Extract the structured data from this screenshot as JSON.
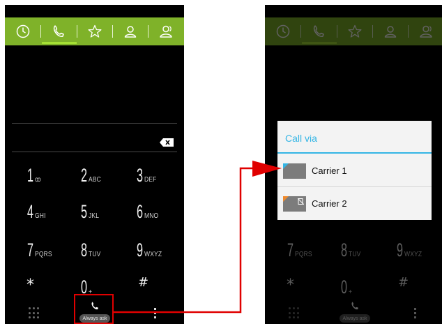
{
  "dialer": {
    "keys": [
      {
        "digit": "1",
        "letters": "ꝏ"
      },
      {
        "digit": "2",
        "letters": "ABC"
      },
      {
        "digit": "3",
        "letters": "DEF"
      },
      {
        "digit": "4",
        "letters": "GHI"
      },
      {
        "digit": "5",
        "letters": "JKL"
      },
      {
        "digit": "6",
        "letters": "MNO"
      },
      {
        "digit": "7",
        "letters": "PQRS"
      },
      {
        "digit": "8",
        "letters": "TUV"
      },
      {
        "digit": "9",
        "letters": "WXYZ"
      }
    ],
    "star": "*",
    "zero": {
      "digit": "0",
      "letters": "+"
    },
    "hash": "#",
    "call_badge": "Always ask"
  },
  "call_via_dialog": {
    "title": "Call via",
    "options": [
      {
        "label": "Carrier 1"
      },
      {
        "label": "Carrier 2"
      }
    ]
  },
  "icons": {
    "tabs": [
      "recent-clock-icon",
      "phone-icon",
      "star-icon",
      "person-icon",
      "people-icon"
    ],
    "backspace": "backspace-icon",
    "dialpad": "dialpad-icon",
    "menu": "overflow-menu-icon"
  },
  "colors": {
    "tab_bar": "#7fb229",
    "tab_active": "#a5e035",
    "dialog_accent": "#33b5e5",
    "annotation": "#e00000"
  }
}
